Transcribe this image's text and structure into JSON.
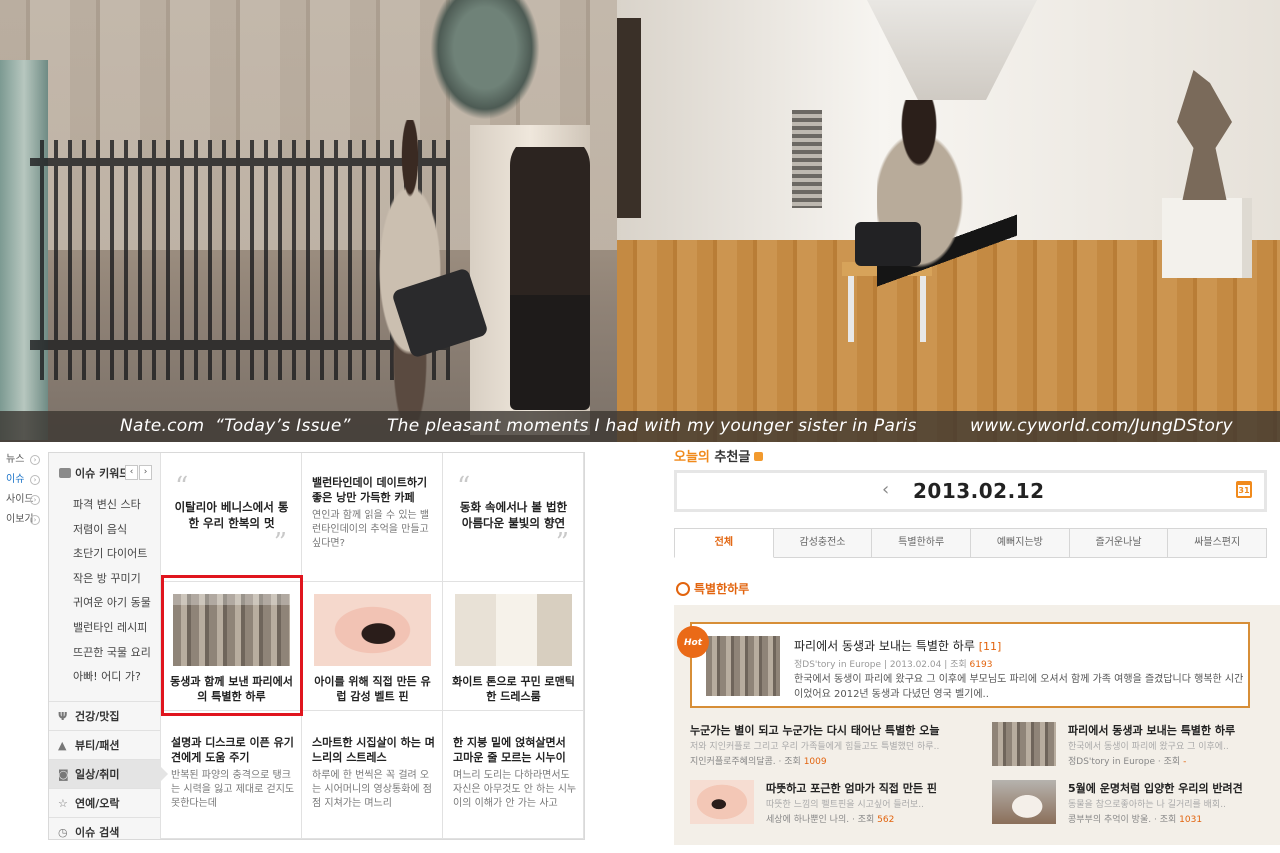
{
  "banner": {
    "site": "Nate.com",
    "issue": "“Today’s Issue”",
    "description": "The pleasant moments I had with my younger sister in Paris",
    "url": "www.cyworld.com/JungDStory"
  },
  "far_left_nav": [
    {
      "label": "뉴스",
      "active": false
    },
    {
      "label": "이슈",
      "active": true
    },
    {
      "label": "사이드",
      "active": false
    },
    {
      "label": "이보기",
      "active": false
    }
  ],
  "issue_module": {
    "keyword_header": "이슈 키워드",
    "prev_icon": "chevron-left-icon",
    "next_icon": "chevron-right-icon",
    "keywords": [
      "파격 변신 스타",
      "저렴이 음식",
      "초단기 다이어트",
      "작은 방 꾸미기",
      "귀여운 아기 동물",
      "밸런타인 레시피",
      "뜨끈한 국물 요리",
      "아빠! 어디 가?"
    ],
    "categories": [
      {
        "label": "건강/맛집",
        "icon": "fork-icon",
        "active": false
      },
      {
        "label": "뷰티/패션",
        "icon": "shirt-icon",
        "active": false
      },
      {
        "label": "일상/취미",
        "icon": "camera-icon",
        "active": true
      },
      {
        "label": "연예/오락",
        "icon": "star-icon",
        "active": false
      },
      {
        "label": "이슈 검색",
        "icon": "clock-icon",
        "active": false
      }
    ],
    "cells": {
      "quote1": "이탈리아 베니스에서 통한 우리 한복의 멋",
      "text1_title": "밸런타인데이 데이트하기 좋은 낭만 가득한 카페",
      "text1_body": "연인과 함께 읽을 수 있는 밸런타인데이의 추억을 만들고 싶다면?",
      "quote2": "동화 속에서나 볼 법한 아름다운 불빛의 향연",
      "photo1": "동생과 함께 보낸 파리에서의 특별한 하루",
      "photo2": "아이를 위해 직접 만든 유럽 감성 벨트 핀",
      "photo3": "화이트 톤으로 꾸민 로맨틱한 드레스룸",
      "b1_title": "설명과 디스크로 이픈 유기견에게 도움 주기",
      "b1_body": "반복된 파양의 충격으로 탱크는 시력을 잃고 제대로 걷지도 못한다는데",
      "b2_title": "스마트한 시집살이 하는 며느리의 스트레스",
      "b2_body": "하루에 한 번씩은 꼭 걸려 오는 시어머니의 영상통화에 점점 지쳐가는 며느리",
      "b3_title": "한 지붕 밑에 얹혀살면서 고마운 줄 모르는 시누이",
      "b3_body": "며느리 도리는 다하라면서도 자신은 아무것도 안 하는 시누이의 이해가 안 가는 사고"
    }
  },
  "cyworld": {
    "title_accent": "오늘의",
    "title_rest": " 추천글",
    "date": "2013.02.12",
    "calendar_day": "31",
    "tabs": [
      "전체",
      "감성충전소",
      "특별한하루",
      "예뻐지는방",
      "즐거운나날",
      "싸블스편지"
    ],
    "section_title": "특별한하루",
    "hot": {
      "badge": "Hot",
      "title": "파리에서 동생과 보내는 특별한 하루",
      "count": "[11]",
      "author": "정DS'tory in Europe",
      "date": "2013.02.04",
      "views_label": "조회",
      "views": "6193",
      "desc": "한국에서 동생이 파리에 왔구요 그 이후에 부모님도 파리에 오셔서 함께 가족 여행을 즐겼답니다 행복한 시간이었어요 2012년 동생과 다녔던 영국 벨기에.."
    },
    "items": [
      {
        "title": "누군가는 별이 되고 누군가는 다시 태어난 특별한 오늘",
        "sub": "저와 지인커플로 그리고 우리 가족들에게 힘들고도 특별했던 하루..",
        "author": "지인커플로주혜의달콤.",
        "views_label": "조회",
        "views": "1009"
      },
      {
        "title": "파리에서 동생과 보내는 특별한 하루",
        "sub": "한국에서 동생이 파리에 왔구요 그 이후에..",
        "author": "정DS'tory in Europe",
        "views_label": "조회",
        "views": "-"
      },
      {
        "title": "따뜻하고 포근한 엄마가 직접 만든 핀",
        "sub": "따뜻한 느낌의 펠트핀을 시고싶어 들러보..",
        "author": "세상에 하나뿐인 나의.",
        "views_label": "조회",
        "views": "562"
      },
      {
        "title": "5월에 운명처럼 입양한 우리의 반려견",
        "sub": "동물을 참으로좋아하는 나 길거리를 배회..",
        "author": "콩부부의 추억이 방울.",
        "views_label": "조회",
        "views": "1031"
      }
    ]
  }
}
